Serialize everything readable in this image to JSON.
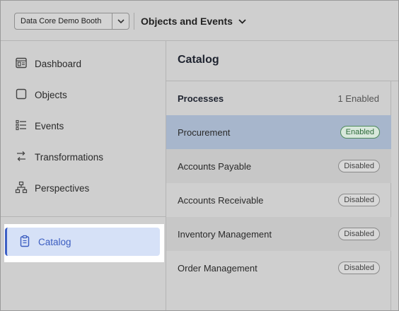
{
  "header": {
    "workspace": "Data Core Demo Booth",
    "module": "Objects and Events"
  },
  "sidebar": {
    "items": [
      {
        "label": "Dashboard",
        "icon": "dashboard-icon"
      },
      {
        "label": "Objects",
        "icon": "square-icon"
      },
      {
        "label": "Events",
        "icon": "list-icon"
      },
      {
        "label": "Transformations",
        "icon": "transform-icon"
      },
      {
        "label": "Perspectives",
        "icon": "hierarchy-icon"
      }
    ],
    "active": {
      "label": "Catalog",
      "icon": "clipboard-icon"
    }
  },
  "main": {
    "title": "Catalog",
    "processes": {
      "heading": "Processes",
      "count": "1 Enabled",
      "rows": [
        {
          "name": "Procurement",
          "status": "Enabled"
        },
        {
          "name": "Accounts Payable",
          "status": "Disabled"
        },
        {
          "name": "Accounts Receivable",
          "status": "Disabled"
        },
        {
          "name": "Inventory Management",
          "status": "Disabled"
        },
        {
          "name": "Order Management",
          "status": "Disabled"
        }
      ]
    }
  },
  "colors": {
    "accent": "#3d5fc4",
    "selected_row": "#a7b6cc",
    "enabled_badge": "#2d6a3a"
  }
}
